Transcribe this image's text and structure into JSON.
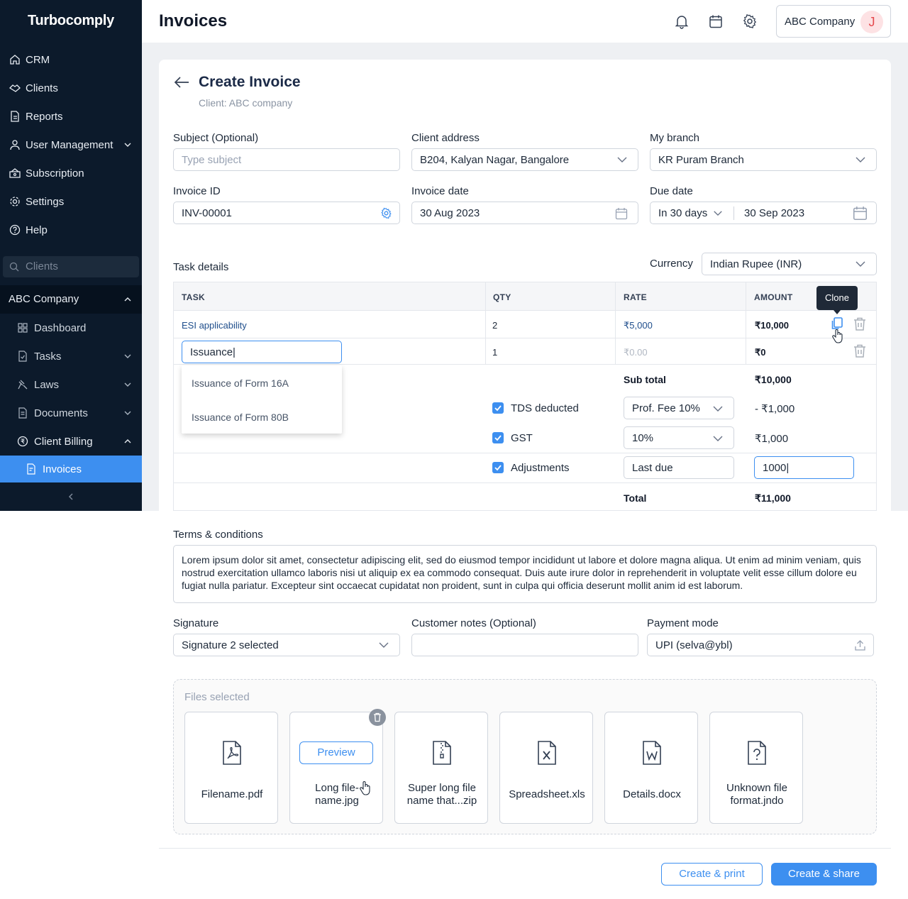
{
  "sidebar": {
    "logo": "Turbocomply",
    "items": [
      {
        "label": "CRM"
      },
      {
        "label": "Clients"
      },
      {
        "label": "Reports"
      },
      {
        "label": "User Management"
      },
      {
        "label": "Subscription"
      },
      {
        "label": "Settings"
      },
      {
        "label": "Help"
      }
    ],
    "search_placeholder": "Clients",
    "company": "ABC Company",
    "company_items": [
      {
        "label": "Dashboard"
      },
      {
        "label": "Tasks"
      },
      {
        "label": "Laws"
      },
      {
        "label": "Documents"
      },
      {
        "label": "Client Billing"
      },
      {
        "label": "Invoices"
      }
    ]
  },
  "header": {
    "title": "Invoices",
    "company": "ABC Company",
    "avatar_initial": "J"
  },
  "form": {
    "title": "Create Invoice",
    "client": "Client: ABC company",
    "subject_label": "Subject (Optional)",
    "subject_placeholder": "Type subject",
    "client_address_label": "Client address",
    "client_address": "B204, Kalyan Nagar, Bangalore",
    "branch_label": "My branch",
    "branch": "KR Puram Branch",
    "invoice_id_label": "Invoice ID",
    "invoice_id": "INV-00001",
    "invoice_date_label": "Invoice date",
    "invoice_date": "30 Aug 2023",
    "due_date_label": "Due date",
    "due_term": "In 30 days",
    "due_date": "30 Sep 2023",
    "task_details_label": "Task details",
    "currency_label": "Currency",
    "currency": "Indian Rupee (INR)"
  },
  "table": {
    "headers": [
      "TASK",
      "QTY",
      "RATE",
      "AMOUNT"
    ],
    "rows": [
      {
        "task": "ESI applicability",
        "qty": "2",
        "rate": "₹5,000",
        "amount": "₹10,000"
      },
      {
        "task": "Issuance|",
        "qty": "1",
        "rate": "₹0.00",
        "amount": "₹0"
      }
    ],
    "suggestions": [
      "Issuance of Form 16A",
      "Issuance of Form 80B"
    ],
    "tooltip": "Clone",
    "subtotal_label": "Sub total",
    "subtotal": "₹10,000",
    "tds_label": "TDS deducted",
    "tds_option": "Prof. Fee 10%",
    "tds_amount": "- ₹1,000",
    "gst_label": "GST",
    "gst_option": "10%",
    "gst_amount": "₹1,000",
    "adj_label": "Adjustments",
    "adj_name": "Last due",
    "adj_value": "1000|",
    "total_label": "Total",
    "total": "₹11,000"
  },
  "terms": {
    "label": "Terms & conditions",
    "text": "Lorem ipsum dolor sit amet, consectetur adipiscing elit, sed do eiusmod tempor incididunt ut labore et dolore magna aliqua. Ut enim ad minim veniam, quis nostrud exercitation ullamco laboris nisi ut aliquip ex ea commodo consequat. Duis aute irure dolor in reprehenderit in voluptate velit esse cillum dolore eu fugiat nulla pariatur. Excepteur sint occaecat cupidatat non proident, sunt in culpa qui officia deserunt mollit anim id est laborum."
  },
  "signature": {
    "label": "Signature",
    "value": "Signature 2 selected"
  },
  "notes": {
    "label": "Customer notes (Optional)",
    "value": ""
  },
  "payment": {
    "label": "Payment mode",
    "value": "UPI (selva@ybl)"
  },
  "files": {
    "label": "Files selected",
    "preview_label": "Preview",
    "items": [
      {
        "name": "Filename.pdf",
        "icon": "pdf-file-icon"
      },
      {
        "name": "Long file-name.jpg",
        "icon": "image-file-icon"
      },
      {
        "name": "Super long file name that...zip",
        "icon": "zip-file-icon"
      },
      {
        "name": "Spreadsheet.xls",
        "icon": "xls-file-icon"
      },
      {
        "name": "Details.docx",
        "icon": "docx-file-icon"
      },
      {
        "name": "Unknown file format.jndo",
        "icon": "unknown-file-icon"
      }
    ]
  },
  "actions": {
    "print": "Create & print",
    "share": "Create & share"
  },
  "colors": {
    "sidebar": "#0c1a2b",
    "accent": "#3d8ff0",
    "active": "#3d8ff0"
  }
}
